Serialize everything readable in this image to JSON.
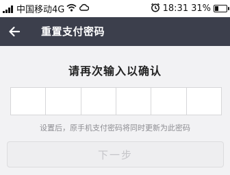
{
  "status_bar": {
    "carrier": "中国移动4G",
    "time": "18:31",
    "battery_percent": "31%",
    "battery_level": 0.31,
    "signal_icon": "signal-bars-icon",
    "wifi_icon": "wifi-icon",
    "cloud_icon": "cloud-icon",
    "alarm_icon": "alarm-clock-icon"
  },
  "title_bar": {
    "back_icon": "arrow-left-icon",
    "title": "重置支付密码",
    "background": "#3c3f4c"
  },
  "main": {
    "prompt": "请再次输入以确认",
    "pin_cells": 6,
    "hint": "设置后，原手机支付密码将同时更新为此密码",
    "next_button_label": "下一步"
  }
}
